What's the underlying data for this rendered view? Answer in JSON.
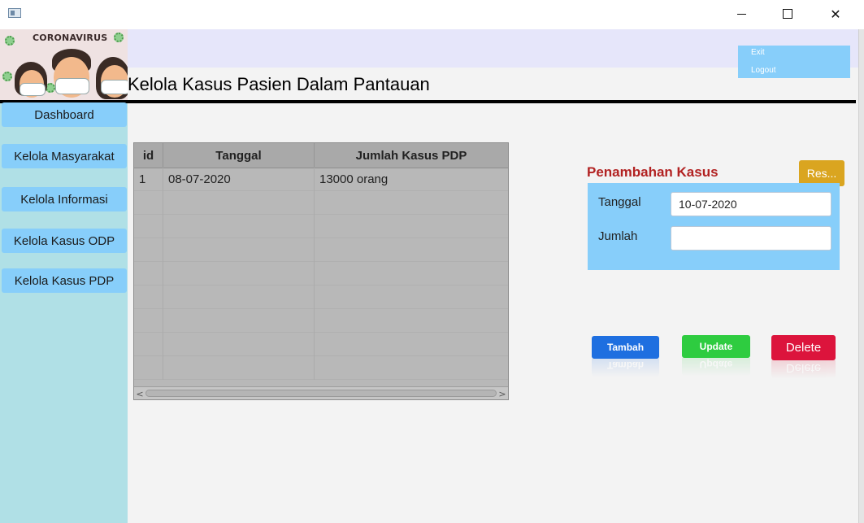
{
  "window": {
    "controls": {
      "minimize_icon": "minimize-icon",
      "maximize_icon": "maximize-icon",
      "close_glyph": "✕"
    }
  },
  "logo": {
    "text": "CORONAVIRUS"
  },
  "header": {
    "title": "Kelola Kasus Pasien Dalam Pantauan"
  },
  "account": {
    "exit_label": "Exit",
    "logout_label": "Logout"
  },
  "sidebar": {
    "items": [
      {
        "label": "Dashboard"
      },
      {
        "label": "Kelola Masyarakat"
      },
      {
        "label": "Kelola Informasi"
      },
      {
        "label": "Kelola Kasus ODP"
      },
      {
        "label": "Kelola Kasus PDP"
      }
    ]
  },
  "table": {
    "columns": [
      "id",
      "Tanggal",
      "Jumlah Kasus PDP"
    ],
    "rows": [
      [
        "1",
        "08-07-2020",
        "13000 orang"
      ]
    ],
    "scroll_left": "<",
    "scroll_right": ">"
  },
  "form": {
    "title": "Penambahan Kasus",
    "reset_label": "Res...",
    "tanggal_label": "Tanggal",
    "tanggal_value": "10-07-2020",
    "jumlah_label": "Jumlah",
    "jumlah_value": ""
  },
  "actions": {
    "tambah_label": "Tambah",
    "update_label": "Update",
    "delete_label": "Delete"
  },
  "colors": {
    "sidebar_bg": "#b0e0e6",
    "nav_button": "#87cefa",
    "form_title": "#b22222",
    "reset": "#daa520",
    "tambah": "#1e6fe0",
    "update": "#2ecc40",
    "delete": "#dc143c"
  }
}
